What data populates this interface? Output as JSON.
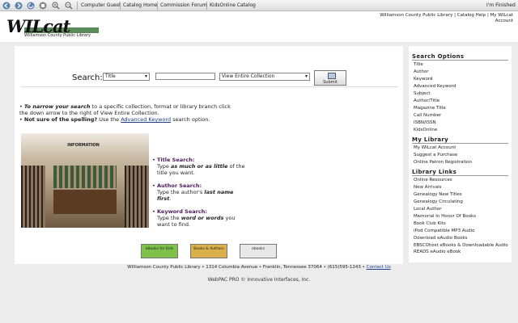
{
  "toolbar": {
    "links": [
      "Computer Guest",
      "Catalog Home",
      "Commission Forum",
      "KidsOnline Catalog"
    ],
    "status": "I'm Finished"
  },
  "header": {
    "logo_word": "WILcat",
    "logo_sub": "Williamson County Public Library",
    "toplinks": {
      "library": "Williamson County Public Library",
      "help": "Catalog Help",
      "account": "My WILcat Account"
    }
  },
  "search": {
    "label": "Search:",
    "type_value": "Title",
    "collection_value": "View Entire Collection",
    "input_value": "",
    "submit_label": "Submit"
  },
  "tips": {
    "t1_bold": "To narrow your search",
    "t1_rest": " to a specific collection, format or library branch click the down arrow to the right of View Entire Collection.",
    "t2_bold": "Not sure of the spelling?",
    "t2_mid": " Use the ",
    "t2_link": "Advanced Keyword",
    "t2_rest": " search option."
  },
  "photo": {
    "sign": "INFORMATION"
  },
  "help": [
    {
      "title": "Title Search:",
      "line1": "Type ",
      "em": "as much or as little",
      "line2": " of the title you want."
    },
    {
      "title": "Author Search:",
      "line1": "Type the author's ",
      "em": "last name first",
      "line2": "."
    },
    {
      "title": "Keyword Search:",
      "line1": "Type the ",
      "em": "word or words",
      "line2": " you want to find."
    }
  ],
  "image_buttons": [
    "eBooks for Kids",
    "Books & Authors",
    "ebooks"
  ],
  "footer": {
    "address": "Williamson County Public Library • 1314 Columbia Avenue • Franklin, Tennessee 37064 • (615)595-1243 • ",
    "contact": "Contact Us",
    "webpac": "WebPAC PRO © Innovative Interfaces, Inc."
  },
  "sidebar": {
    "search_options_title": "Search Options",
    "search_options": [
      "Title",
      "Author",
      "Keyword",
      "Advanced Keyword",
      "Subject",
      "Author/Title",
      "Magazine Title",
      "Call Number",
      "ISBN/ISSN",
      "KidsOnline"
    ],
    "my_library_title": "My Library",
    "my_library": [
      "My WILcat Account",
      "Suggest a Purchase",
      "Online Patron Registration"
    ],
    "links_title": "Library Links",
    "links": [
      "Online Resources",
      "New Arrivals",
      "Genealogy New Titles",
      "Genealogy Circulating",
      "Local Author",
      "Memorial In Honor Of Books",
      "Book Club Kits",
      "iPod Compatible MP3 Audio",
      "Download eAudio Books",
      "EBSCOhost eBooks & Downloadable Audio",
      "READS eAudio eBook"
    ]
  }
}
